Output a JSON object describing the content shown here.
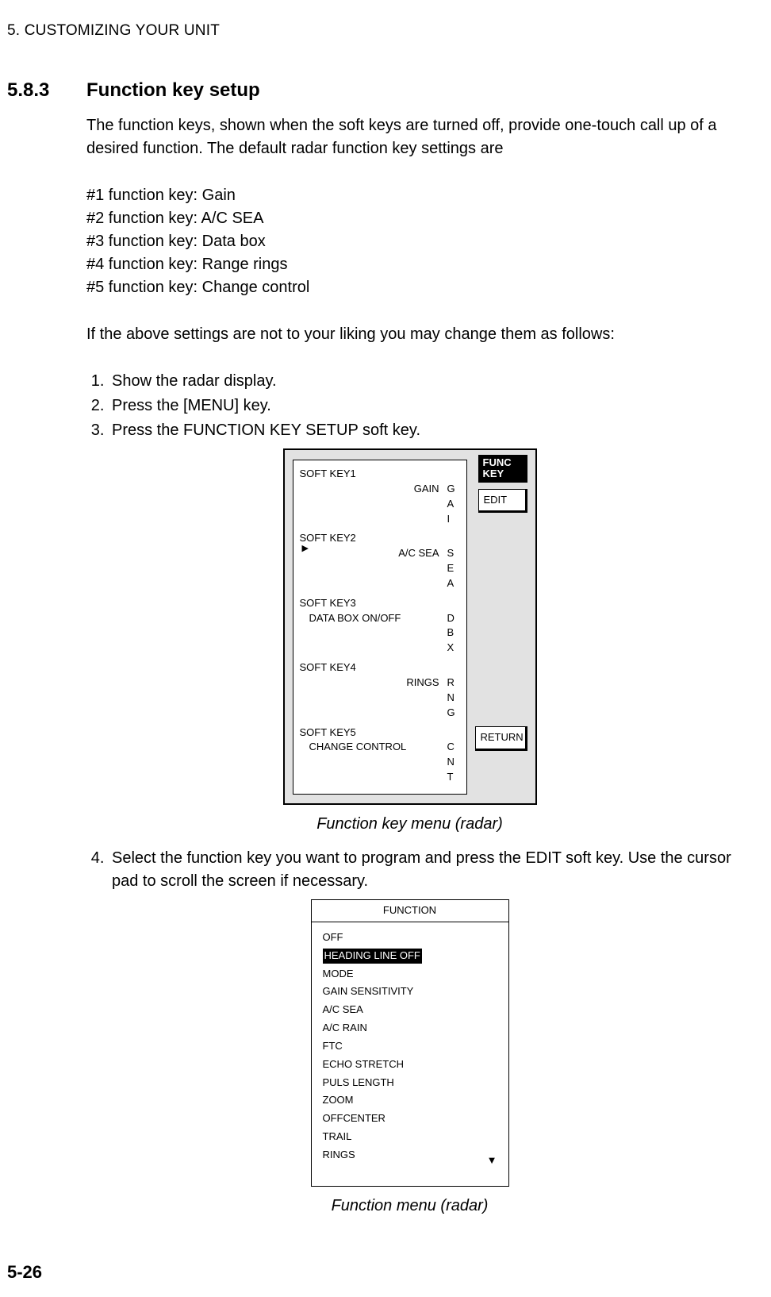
{
  "header": "5. CUSTOMIZING YOUR UNIT",
  "section": {
    "num": "5.8.3",
    "title": "Function key setup"
  },
  "intro1": "The function keys, shown when the soft keys are turned off, provide one-touch call up of a desired function. The default radar function key settings are",
  "defs": {
    "l1": "#1 function key: Gain",
    "l2": "#2 function key: A/C SEA",
    "l3": "#3 function key: Data box",
    "l4": "#4 function key: Range rings",
    "l5": "#5 function key: Change control"
  },
  "intro2": "If the above settings are not to your liking you may change them as follows:",
  "steps": {
    "s1": "Show the radar display.",
    "s2": "Press the [MENU] key.",
    "s3": "Press the FUNCTION KEY SETUP soft key.",
    "s4": "Select the function key you want to program and press the EDIT soft key. Use the cursor pad to scroll the screen if necessary."
  },
  "fig1": {
    "sk1": {
      "label": "SOFT KEY1",
      "value": "GAIN",
      "c1": "G",
      "c2": "A",
      "c3": "I"
    },
    "sk2": {
      "label": "SOFT KEY2",
      "value": "A/C SEA",
      "c1": "S",
      "c2": "E",
      "c3": "A"
    },
    "sk3": {
      "label": "SOFT KEY3",
      "value": "DATA BOX ON/OFF",
      "c1": "D",
      "c2": "B",
      "c3": "X"
    },
    "sk4": {
      "label": "SOFT KEY4",
      "value": "RINGS",
      "c1": "R",
      "c2": "N",
      "c3": "G"
    },
    "sk5": {
      "label": "SOFT KEY5",
      "value": "CHANGE CONTROL",
      "c1": "C",
      "c2": "N",
      "c3": "T"
    },
    "ptr": "▶",
    "func": "FUNC",
    "key": "KEY",
    "edit": "EDIT",
    "return": "RETURN",
    "caption": "Function key menu (radar)"
  },
  "fig2": {
    "title": "FUNCTION",
    "i0": "OFF",
    "i1": "HEADING LINE OFF",
    "i2": "MODE",
    "i3": "GAIN SENSITIVITY",
    "i4": "A/C SEA",
    "i5": "A/C RAIN",
    "i6": "FTC",
    "i7": "ECHO STRETCH",
    "i8": "PULS LENGTH",
    "i9": "ZOOM",
    "i10": "OFFCENTER",
    "i11": "TRAIL",
    "i12": "RINGS",
    "down": "▼",
    "caption": "Function menu (radar)"
  },
  "pagenum": "5-26"
}
